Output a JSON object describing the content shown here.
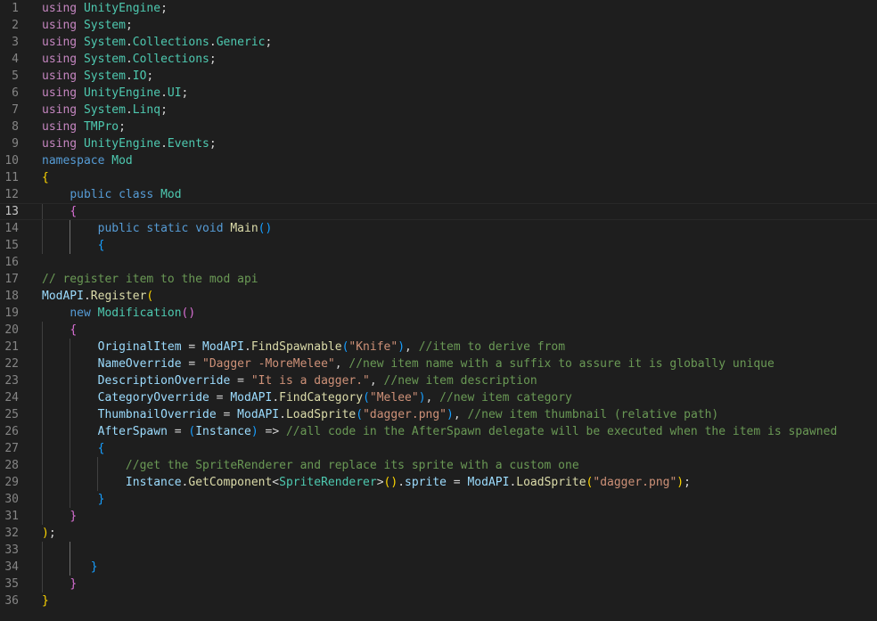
{
  "editor": {
    "language": "csharp",
    "current_line": 13,
    "colors": {
      "background": "#1e1e1e",
      "line_number": "#858585",
      "keyword": "#569cd6",
      "control_keyword": "#c586c0",
      "type": "#4ec9b0",
      "function": "#dcdcaa",
      "variable": "#9cdcfe",
      "string": "#ce9178",
      "comment": "#6a9955",
      "bracket_level_1": "#ffd700",
      "bracket_level_2": "#da70d6",
      "bracket_level_3": "#179fff"
    },
    "lines": [
      {
        "n": "1",
        "tokens": [
          [
            "ctl",
            "using"
          ],
          [
            "plain",
            " "
          ],
          [
            "type",
            "UnityEngine"
          ],
          [
            "plain",
            ";"
          ]
        ]
      },
      {
        "n": "2",
        "tokens": [
          [
            "ctl",
            "using"
          ],
          [
            "plain",
            " "
          ],
          [
            "type",
            "System"
          ],
          [
            "plain",
            ";"
          ]
        ]
      },
      {
        "n": "3",
        "tokens": [
          [
            "ctl",
            "using"
          ],
          [
            "plain",
            " "
          ],
          [
            "type",
            "System"
          ],
          [
            "plain",
            "."
          ],
          [
            "type",
            "Collections"
          ],
          [
            "plain",
            "."
          ],
          [
            "type",
            "Generic"
          ],
          [
            "plain",
            ";"
          ]
        ]
      },
      {
        "n": "4",
        "tokens": [
          [
            "ctl",
            "using"
          ],
          [
            "plain",
            " "
          ],
          [
            "type",
            "System"
          ],
          [
            "plain",
            "."
          ],
          [
            "type",
            "Collections"
          ],
          [
            "plain",
            ";"
          ]
        ]
      },
      {
        "n": "5",
        "tokens": [
          [
            "ctl",
            "using"
          ],
          [
            "plain",
            " "
          ],
          [
            "type",
            "System"
          ],
          [
            "plain",
            "."
          ],
          [
            "type",
            "IO"
          ],
          [
            "plain",
            ";"
          ]
        ]
      },
      {
        "n": "6",
        "tokens": [
          [
            "ctl",
            "using"
          ],
          [
            "plain",
            " "
          ],
          [
            "type",
            "UnityEngine"
          ],
          [
            "plain",
            "."
          ],
          [
            "type",
            "UI"
          ],
          [
            "plain",
            ";"
          ]
        ]
      },
      {
        "n": "7",
        "tokens": [
          [
            "ctl",
            "using"
          ],
          [
            "plain",
            " "
          ],
          [
            "type",
            "System"
          ],
          [
            "plain",
            "."
          ],
          [
            "type",
            "Linq"
          ],
          [
            "plain",
            ";"
          ]
        ]
      },
      {
        "n": "8",
        "tokens": [
          [
            "ctl",
            "using"
          ],
          [
            "plain",
            " "
          ],
          [
            "type",
            "TMPro"
          ],
          [
            "plain",
            ";"
          ]
        ]
      },
      {
        "n": "9",
        "tokens": [
          [
            "ctl",
            "using"
          ],
          [
            "plain",
            " "
          ],
          [
            "type",
            "UnityEngine"
          ],
          [
            "plain",
            "."
          ],
          [
            "type",
            "Events"
          ],
          [
            "plain",
            ";"
          ]
        ]
      },
      {
        "n": "10",
        "tokens": [
          [
            "kw",
            "namespace"
          ],
          [
            "plain",
            " "
          ],
          [
            "type",
            "Mod"
          ]
        ]
      },
      {
        "n": "11",
        "tokens": [
          [
            "b1",
            "{"
          ]
        ]
      },
      {
        "n": "12",
        "tokens": [
          [
            "plain",
            "    "
          ],
          [
            "kw",
            "public"
          ],
          [
            "plain",
            " "
          ],
          [
            "kw",
            "class"
          ],
          [
            "plain",
            " "
          ],
          [
            "type",
            "Mod"
          ]
        ]
      },
      {
        "n": "13",
        "tokens": [
          [
            "plain",
            "    "
          ],
          [
            "b2",
            "{"
          ]
        ]
      },
      {
        "n": "14",
        "tokens": [
          [
            "plain",
            "        "
          ],
          [
            "kw",
            "public"
          ],
          [
            "plain",
            " "
          ],
          [
            "kw",
            "static"
          ],
          [
            "plain",
            " "
          ],
          [
            "kw",
            "void"
          ],
          [
            "plain",
            " "
          ],
          [
            "fn",
            "Main"
          ],
          [
            "b3",
            "()"
          ]
        ]
      },
      {
        "n": "15",
        "tokens": [
          [
            "plain",
            "        "
          ],
          [
            "b3",
            "{"
          ]
        ]
      },
      {
        "n": "16",
        "tokens": []
      },
      {
        "n": "17",
        "tokens": [
          [
            "cmt",
            "// register item to the mod api"
          ]
        ]
      },
      {
        "n": "18",
        "tokens": [
          [
            "var",
            "ModAPI"
          ],
          [
            "plain",
            "."
          ],
          [
            "fn",
            "Register"
          ],
          [
            "b1",
            "("
          ]
        ]
      },
      {
        "n": "19",
        "tokens": [
          [
            "plain",
            "    "
          ],
          [
            "kw",
            "new"
          ],
          [
            "plain",
            " "
          ],
          [
            "type",
            "Modification"
          ],
          [
            "b2",
            "()"
          ]
        ]
      },
      {
        "n": "20",
        "tokens": [
          [
            "plain",
            "    "
          ],
          [
            "b2",
            "{"
          ]
        ]
      },
      {
        "n": "21",
        "tokens": [
          [
            "plain",
            "        "
          ],
          [
            "var",
            "OriginalItem"
          ],
          [
            "plain",
            " = "
          ],
          [
            "var",
            "ModAPI"
          ],
          [
            "plain",
            "."
          ],
          [
            "fn",
            "FindSpawnable"
          ],
          [
            "b3",
            "("
          ],
          [
            "str",
            "\"Knife\""
          ],
          [
            "b3",
            ")"
          ],
          [
            "plain",
            ", "
          ],
          [
            "cmt",
            "//item to derive from"
          ]
        ]
      },
      {
        "n": "22",
        "tokens": [
          [
            "plain",
            "        "
          ],
          [
            "var",
            "NameOverride"
          ],
          [
            "plain",
            " = "
          ],
          [
            "str",
            "\"Dagger -MoreMelee\""
          ],
          [
            "plain",
            ", "
          ],
          [
            "cmt",
            "//new item name with a suffix to assure it is globally unique"
          ]
        ]
      },
      {
        "n": "23",
        "tokens": [
          [
            "plain",
            "        "
          ],
          [
            "var",
            "DescriptionOverride"
          ],
          [
            "plain",
            " = "
          ],
          [
            "str",
            "\"It is a dagger.\""
          ],
          [
            "plain",
            ", "
          ],
          [
            "cmt",
            "//new item description"
          ]
        ]
      },
      {
        "n": "24",
        "tokens": [
          [
            "plain",
            "        "
          ],
          [
            "var",
            "CategoryOverride"
          ],
          [
            "plain",
            " = "
          ],
          [
            "var",
            "ModAPI"
          ],
          [
            "plain",
            "."
          ],
          [
            "fn",
            "FindCategory"
          ],
          [
            "b3",
            "("
          ],
          [
            "str",
            "\"Melee\""
          ],
          [
            "b3",
            ")"
          ],
          [
            "plain",
            ", "
          ],
          [
            "cmt",
            "//new item category"
          ]
        ]
      },
      {
        "n": "25",
        "tokens": [
          [
            "plain",
            "        "
          ],
          [
            "var",
            "ThumbnailOverride"
          ],
          [
            "plain",
            " = "
          ],
          [
            "var",
            "ModAPI"
          ],
          [
            "plain",
            "."
          ],
          [
            "fn",
            "LoadSprite"
          ],
          [
            "b3",
            "("
          ],
          [
            "str",
            "\"dagger.png\""
          ],
          [
            "b3",
            ")"
          ],
          [
            "plain",
            ", "
          ],
          [
            "cmt",
            "//new item thumbnail (relative path)"
          ]
        ]
      },
      {
        "n": "26",
        "tokens": [
          [
            "plain",
            "        "
          ],
          [
            "var",
            "AfterSpawn"
          ],
          [
            "plain",
            " = "
          ],
          [
            "b3",
            "("
          ],
          [
            "var",
            "Instance"
          ],
          [
            "b3",
            ")"
          ],
          [
            "plain",
            " => "
          ],
          [
            "cmt",
            "//all code in the AfterSpawn delegate will be executed when the item is spawned"
          ]
        ]
      },
      {
        "n": "27",
        "tokens": [
          [
            "plain",
            "        "
          ],
          [
            "b3",
            "{"
          ]
        ]
      },
      {
        "n": "28",
        "tokens": [
          [
            "plain",
            "            "
          ],
          [
            "cmt",
            "//get the SpriteRenderer and replace its sprite with a custom one"
          ]
        ]
      },
      {
        "n": "29",
        "tokens": [
          [
            "plain",
            "            "
          ],
          [
            "var",
            "Instance"
          ],
          [
            "plain",
            "."
          ],
          [
            "fn",
            "GetComponent"
          ],
          [
            "plain",
            "<"
          ],
          [
            "type",
            "SpriteRenderer"
          ],
          [
            "plain",
            ">"
          ],
          [
            "b1",
            "()"
          ],
          [
            "plain",
            "."
          ],
          [
            "var",
            "sprite"
          ],
          [
            "plain",
            " = "
          ],
          [
            "var",
            "ModAPI"
          ],
          [
            "plain",
            "."
          ],
          [
            "fn",
            "LoadSprite"
          ],
          [
            "b1",
            "("
          ],
          [
            "str",
            "\"dagger.png\""
          ],
          [
            "b1",
            ")"
          ],
          [
            "plain",
            ";"
          ]
        ]
      },
      {
        "n": "30",
        "tokens": [
          [
            "plain",
            "        "
          ],
          [
            "b3",
            "}"
          ]
        ]
      },
      {
        "n": "31",
        "tokens": [
          [
            "plain",
            "    "
          ],
          [
            "b2",
            "}"
          ]
        ]
      },
      {
        "n": "32",
        "tokens": [
          [
            "b1",
            ")"
          ],
          [
            "plain",
            ";"
          ]
        ]
      },
      {
        "n": "33",
        "tokens": []
      },
      {
        "n": "34",
        "tokens": [
          [
            "plain",
            "       "
          ],
          [
            "b3",
            "}"
          ]
        ]
      },
      {
        "n": "35",
        "tokens": [
          [
            "plain",
            "    "
          ],
          [
            "b2",
            "}"
          ]
        ]
      },
      {
        "n": "36",
        "tokens": [
          [
            "b1",
            "}"
          ]
        ]
      }
    ]
  }
}
